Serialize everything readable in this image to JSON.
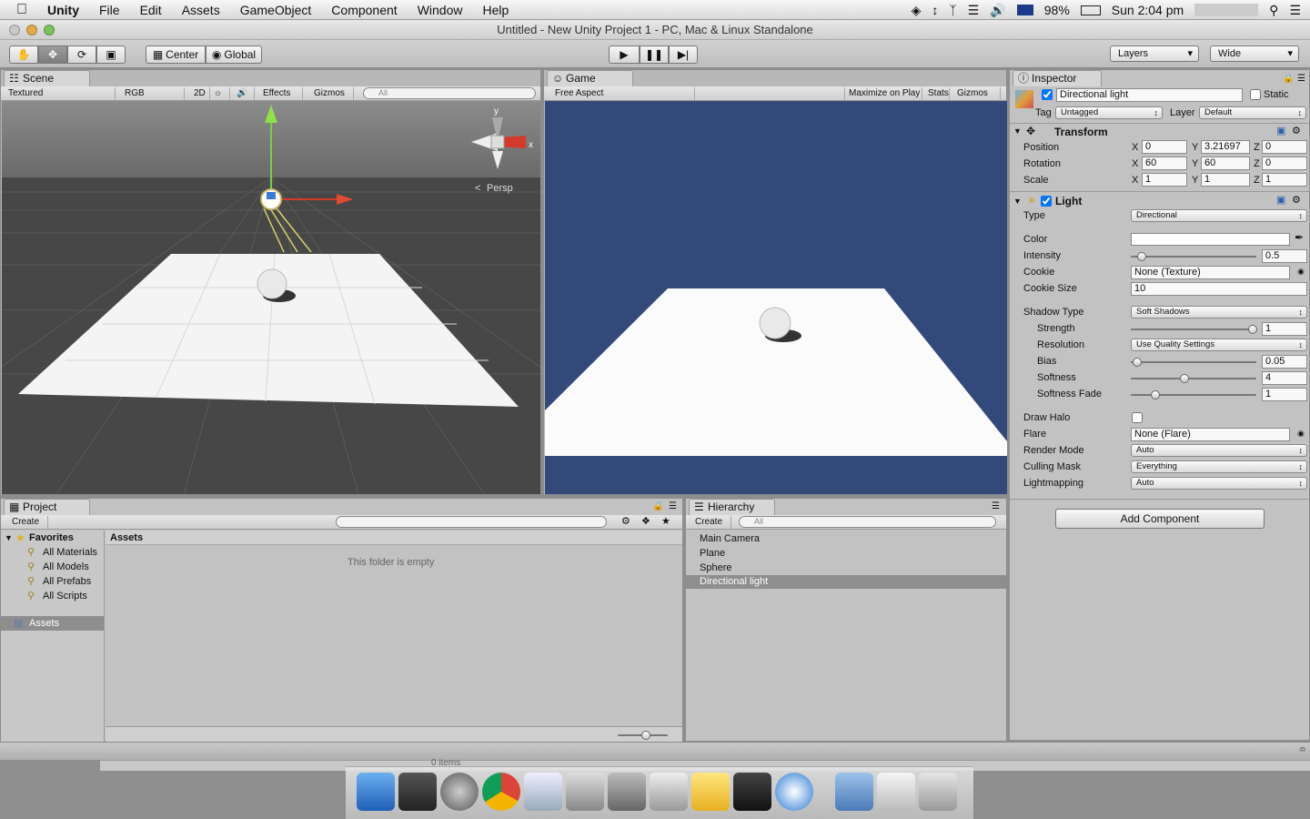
{
  "menubar": {
    "app": "Unity",
    "items": [
      "File",
      "Edit",
      "Assets",
      "GameObject",
      "Component",
      "Window",
      "Help"
    ],
    "battery": "98%",
    "clock": "Sun 2:04 pm"
  },
  "window": {
    "title": "Untitled - New Unity Project 1 - PC, Mac & Linux Standalone"
  },
  "toolbar": {
    "pivot": "Center",
    "space": "Global",
    "layers": "Layers",
    "layout": "Wide"
  },
  "scene": {
    "tab": "Scene",
    "render_mode": "Textured",
    "color_mode": "RGB",
    "mode_2d": "2D",
    "effects": "Effects",
    "gizmos": "Gizmos",
    "search_placeholder": "All",
    "persp": "Persp",
    "gizmo_y": "y",
    "gizmo_x": "x"
  },
  "game": {
    "tab": "Game",
    "aspect": "Free Aspect",
    "maximize": "Maximize on Play",
    "stats": "Stats",
    "gizmos": "Gizmos"
  },
  "inspector": {
    "tab": "Inspector",
    "object_name": "Directional light",
    "static": "Static",
    "tag_label": "Tag",
    "tag": "Untagged",
    "layer_label": "Layer",
    "layer": "Default",
    "transform": {
      "title": "Transform",
      "position": "Position",
      "rotation": "Rotation",
      "scale": "Scale",
      "pos": [
        "0",
        "3.21697",
        "0"
      ],
      "rot": [
        "60",
        "60",
        "0"
      ],
      "scl": [
        "1",
        "1",
        "1"
      ],
      "x": "X",
      "y": "Y",
      "z": "Z"
    },
    "light": {
      "title": "Light",
      "type_label": "Type",
      "type": "Directional",
      "color_label": "Color",
      "intensity_label": "Intensity",
      "intensity": "0.5",
      "cookie_label": "Cookie",
      "cookie": "None (Texture)",
      "cookie_size_label": "Cookie Size",
      "cookie_size": "10",
      "shadow_type_label": "Shadow Type",
      "shadow_type": "Soft Shadows",
      "strength_label": "Strength",
      "strength": "1",
      "resolution_label": "Resolution",
      "resolution": "Use Quality Settings",
      "bias_label": "Bias",
      "bias": "0.05",
      "softness_label": "Softness",
      "softness": "4",
      "softness_fade_label": "Softness Fade",
      "softness_fade": "1",
      "draw_halo_label": "Draw Halo",
      "flare_label": "Flare",
      "flare": "None (Flare)",
      "render_mode_label": "Render Mode",
      "render_mode": "Auto",
      "culling_mask_label": "Culling Mask",
      "culling_mask": "Everything",
      "lightmapping_label": "Lightmapping",
      "lightmapping": "Auto"
    },
    "add_component": "Add Component"
  },
  "project": {
    "tab": "Project",
    "create": "Create",
    "favorites": "Favorites",
    "fav_items": [
      "All Materials",
      "All Models",
      "All Prefabs",
      "All Scripts"
    ],
    "assets": "Assets",
    "assets_header": "Assets",
    "empty": "This folder is empty",
    "count": "0 items"
  },
  "hierarchy": {
    "tab": "Hierarchy",
    "create": "Create",
    "search_placeholder": "All",
    "items": [
      "Main Camera",
      "Plane",
      "Sphere",
      "Directional light"
    ]
  }
}
